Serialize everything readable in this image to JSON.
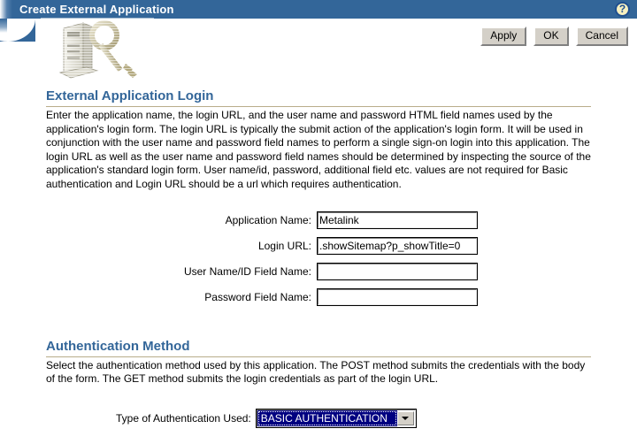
{
  "window": {
    "title": "Create External Application",
    "help_icon": "help-question-icon",
    "help_glyph": "?"
  },
  "toolbar": {
    "apply_label": "Apply",
    "ok_label": "OK",
    "cancel_label": "Cancel"
  },
  "decoration": {
    "graphic_name": "server-with-key-graphic"
  },
  "login_section": {
    "heading": "External Application Login",
    "description": "Enter the application name, the login URL, and the user name and password HTML field names used by the application's login form. The login URL is typically the submit action of the application's login form. It will be used in conjunction with the user name and password field names to perform a single sign-on login into this application. The login URL as well as the user name and password field names should be determined by inspecting the source of the application's standard login form. User name/id, password, additional field etc. values are not required for Basic authentication and Login URL should be a url which requires authentication.",
    "fields": [
      {
        "label": "Application Name:",
        "value": "Metalink",
        "placeholder": "",
        "name": "application-name"
      },
      {
        "label": "Login URL:",
        "value": ".showSitemap?p_showTitle=0",
        "placeholder": "",
        "name": "login-url"
      },
      {
        "label": "User Name/ID Field Name:",
        "value": "",
        "placeholder": "",
        "name": "user-name-id-field-name"
      },
      {
        "label": "Password Field Name:",
        "value": "",
        "placeholder": "",
        "name": "password-field-name"
      }
    ]
  },
  "auth_section": {
    "heading": "Authentication Method",
    "description": "Select the authentication method used by this application. The POST method submits the credentials with the body of the form. The GET method submits the login credentials as part of the login URL.",
    "select_label": "Type of Authentication Used:",
    "selected_value": "BASIC AUTHENTICATION",
    "dropdown_icon": "chevron-down-icon"
  },
  "colors": {
    "banner": "#336699",
    "heading": "#336699",
    "rule": "#b9ad8b",
    "select_highlight": "#000080",
    "button_face": "#d4d0c8"
  }
}
